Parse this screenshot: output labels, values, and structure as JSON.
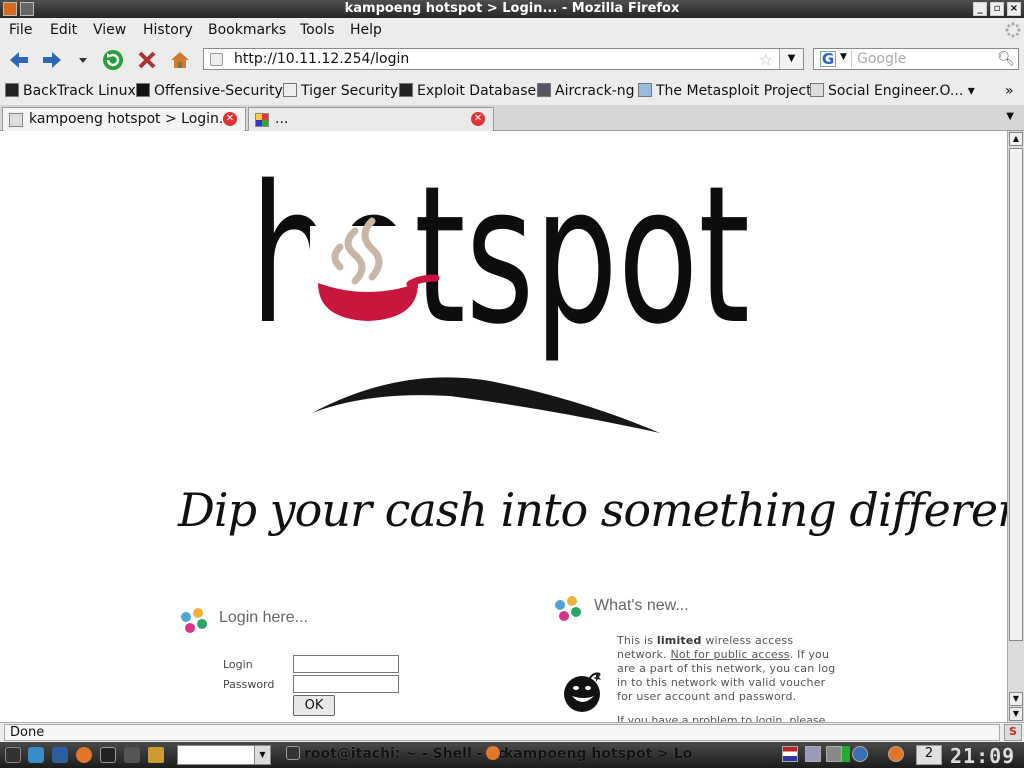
{
  "window": {
    "title": "kampoeng hotspot > Login... - Mozilla Firefox"
  },
  "menu": [
    "File",
    "Edit",
    "View",
    "History",
    "Bookmarks",
    "Tools",
    "Help"
  ],
  "nav": {
    "url": "http://10.11.12.254/login",
    "search_placeholder": "Google"
  },
  "bookmarks": [
    "BackTrack Linux",
    "Offensive-Security",
    "Tiger Security",
    "Exploit Database",
    "Aircrack-ng",
    "The Metasploit Project",
    "Social Engineer.O..."
  ],
  "tabs": [
    {
      "label": "kampoeng hotspot > Login...",
      "active": true
    },
    {
      "label": "...",
      "active": false
    }
  ],
  "page": {
    "logo_text": "hotspot",
    "slogan": "Dip your cash into something different",
    "login": {
      "heading": "Login here...",
      "login_label": "Login",
      "password_label": "Password",
      "login_value": "",
      "password_value": "",
      "submit": "OK"
    },
    "news": {
      "heading": "What's new...",
      "p1_before": "This is ",
      "p1_bold": "limited",
      "p1_after": " wireless access network.",
      "p1_underline": "Not for public access",
      "p1_rest": ". If you are a part of this network, you can log in to this network with valid voucher for user account and password.",
      "p2": "If you have a problem to login, please"
    }
  },
  "status": {
    "text": "Done"
  },
  "taskbar": {
    "tasks": [
      "root@itachi: ~ - Shell - Ko",
      "kampoeng hotspot > Lo"
    ],
    "desktop": "2",
    "clock": "21:09"
  },
  "colors": {
    "accent_red": "#c8163f",
    "steam": "#c8b7a6",
    "logo_black": "#0d0d0d"
  }
}
